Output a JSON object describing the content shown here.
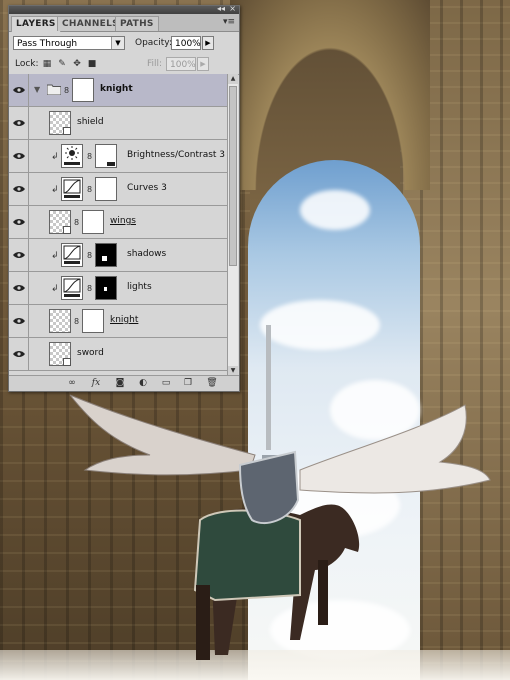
{
  "window": {
    "collapse_glyph": "◂◂",
    "close_glyph": "×"
  },
  "tabs": [
    {
      "label": "LAYERS",
      "active": true
    },
    {
      "label": "CHANNELS",
      "active": false
    },
    {
      "label": "PATHS",
      "active": false
    }
  ],
  "panel_menu_glyph": "▾≡",
  "blend": {
    "mode": "Pass Through",
    "opacity_label": "Opacity:",
    "opacity_value": "100%",
    "lock_label": "Lock:",
    "fill_label": "Fill:",
    "fill_value": "100%"
  },
  "layers": [
    {
      "name": "knight",
      "kind": "group",
      "selected": true
    },
    {
      "name": "shield",
      "kind": "smart"
    },
    {
      "name": "Brightness/Contrast 3",
      "kind": "adjustment-brightness",
      "clipped": true
    },
    {
      "name": "Curves 3",
      "kind": "adjustment-curves",
      "clipped": true
    },
    {
      "name": "wings",
      "kind": "masked-pixel"
    },
    {
      "name": "shadows",
      "kind": "adjustment-curves-masked",
      "clipped": true
    },
    {
      "name": "lights",
      "kind": "adjustment-curves-masked",
      "clipped": true
    },
    {
      "name": "knight",
      "kind": "masked-pixel"
    },
    {
      "name": "sword",
      "kind": "smart"
    }
  ],
  "bottom_buttons": [
    "link-layers",
    "fx",
    "add-mask",
    "adjustment",
    "new-group",
    "new-layer",
    "delete"
  ],
  "icons": {
    "eye": "eye-icon",
    "link": "chain-link-icon",
    "clip": "clip-arrow-icon",
    "folder": "folder-icon"
  }
}
